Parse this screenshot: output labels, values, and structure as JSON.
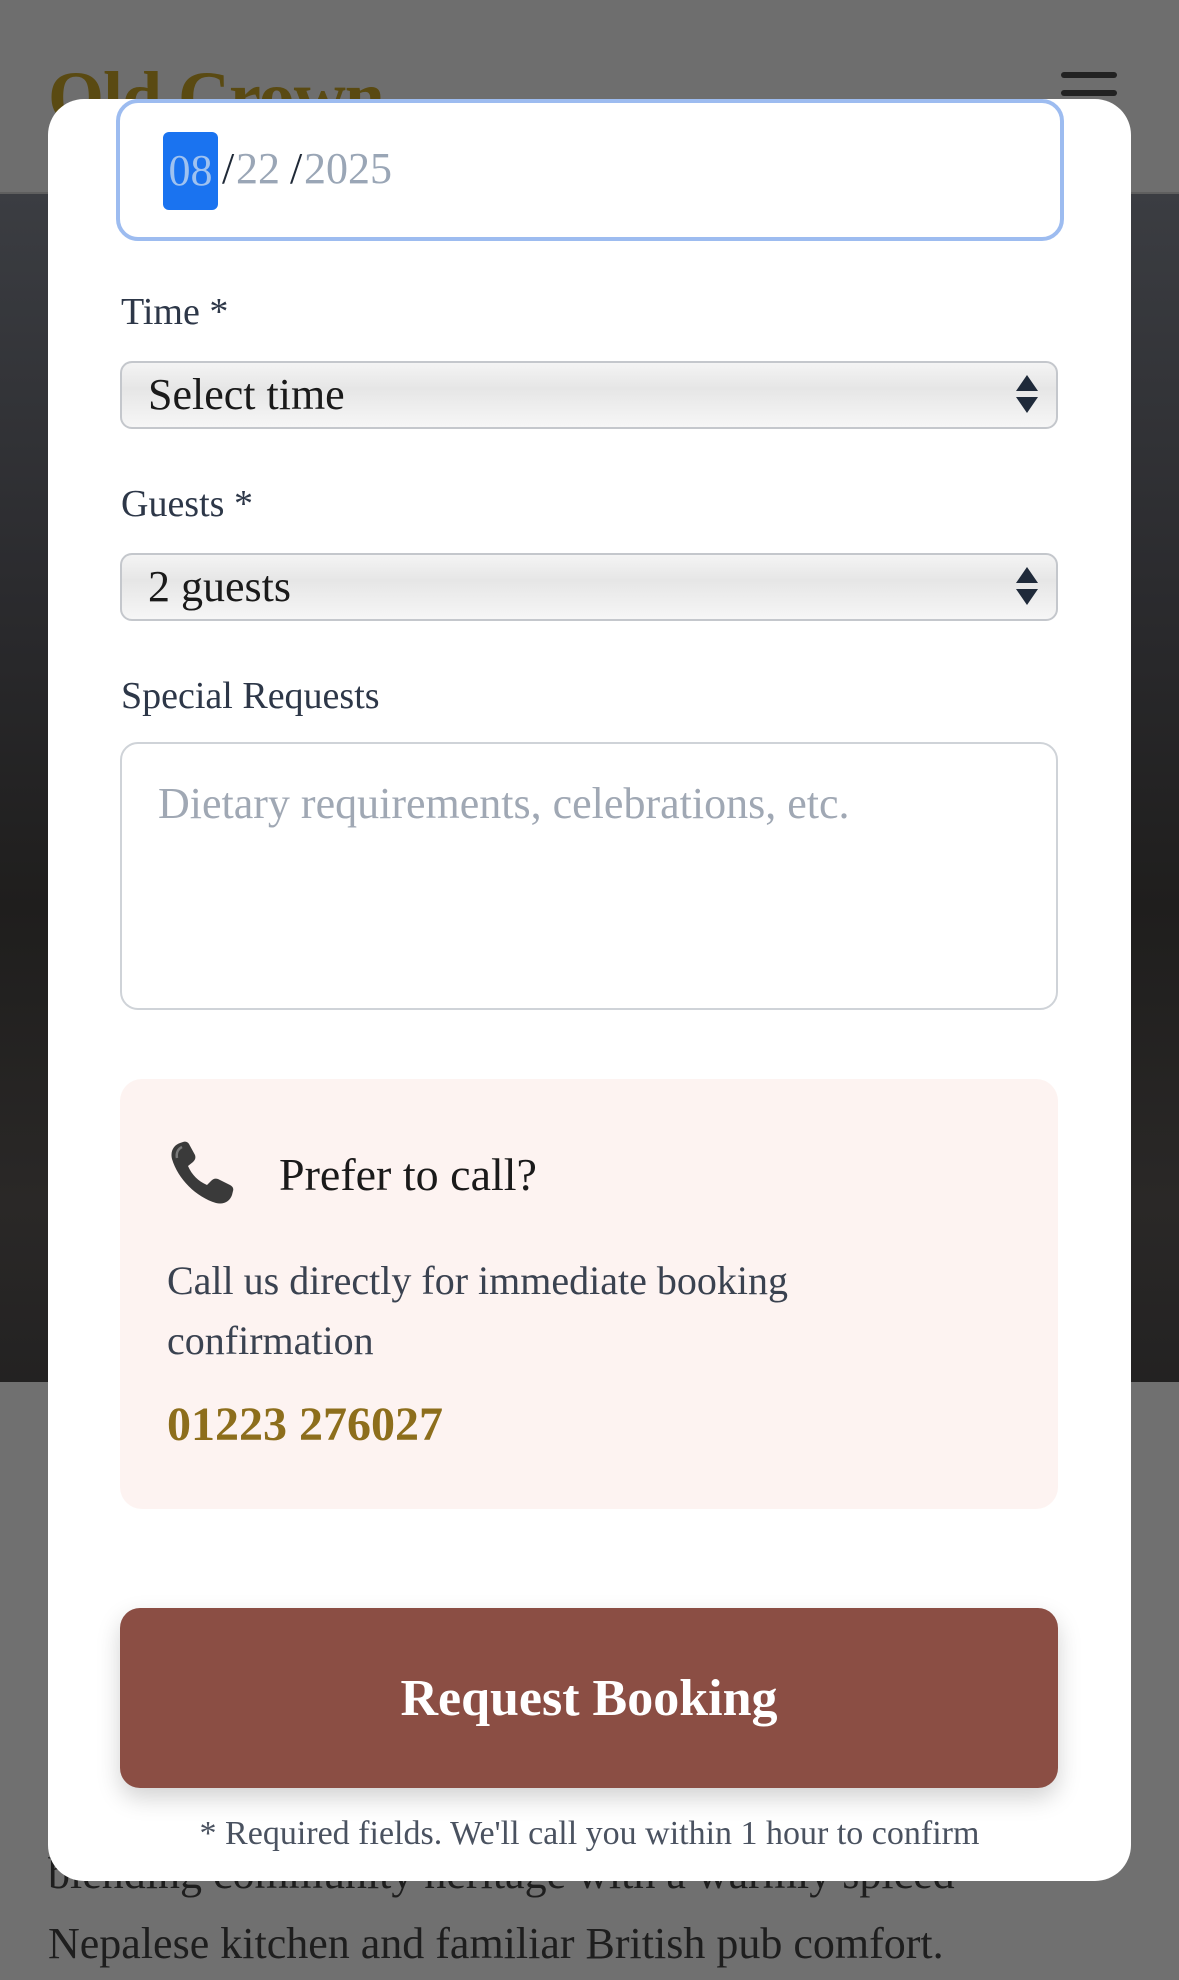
{
  "background": {
    "logo": "Old Crown",
    "text_line_1": "blending community heritage with a warmly spiced",
    "text_line_2": "Nepalese kitchen and familiar British pub comfort."
  },
  "form": {
    "date": {
      "month": "08",
      "day": "22",
      "year": "2025",
      "separator": "/"
    },
    "time": {
      "label": "Time *",
      "value": "Select time"
    },
    "guests": {
      "label": "Guests *",
      "value": "2 guests"
    },
    "requests": {
      "label": "Special Requests",
      "placeholder": "Dietary requirements, celebrations, etc."
    },
    "call": {
      "icon": "phone-icon",
      "title": "Prefer to call?",
      "description": "Call us directly for immediate booking confirmation",
      "phone": "01223 276027"
    },
    "submit_label": "Request Booking",
    "note": "* Required fields. We'll call you within 1 hour to confirm"
  },
  "colors": {
    "accent": "#8b4e44",
    "phone": "#8d6e1c",
    "call_box_bg": "#fdf3f1",
    "focus_ring": "#9dbcf0"
  }
}
